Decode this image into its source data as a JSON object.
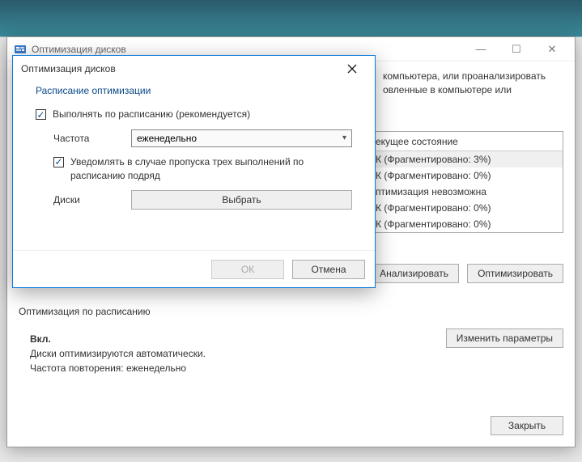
{
  "parent": {
    "title": "Оптимизация дисков",
    "desc_tail_line1": "компьютера, или проанализировать",
    "desc_tail_line2": "овленные в компьютере или",
    "table": {
      "header_state": "екущее состояние",
      "rows": [
        "К (Фрагментировано: 3%)",
        "К (Фрагментировано: 0%)",
        "птимизация невозможна",
        "К (Фрагментировано: 0%)",
        "К (Фрагментировано: 0%)"
      ]
    },
    "analyze_label": "Анализировать",
    "optimize_label": "Оптимизировать",
    "sched_heading": "Оптимизация по расписанию",
    "sched_on": "Вкл.",
    "sched_auto": "Диски оптимизируются автоматически.",
    "sched_freq": "Частота повторения: еженедельно",
    "change_params_label": "Изменить параметры",
    "close_label": "Закрыть",
    "winctrl_min": "—",
    "winctrl_max": "☐",
    "winctrl_close": "✕"
  },
  "dialog": {
    "title": "Оптимизация дисков",
    "heading": "Расписание оптимизации",
    "chk_schedule": "Выполнять по расписанию (рекомендуется)",
    "freq_label": "Частота",
    "freq_value": "еженедельно",
    "chk_notify": "Уведомлять в случае пропуска трех выполнений по расписанию подряд",
    "disks_label": "Диски",
    "choose_label": "Выбрать",
    "ok_label": "ОК",
    "cancel_label": "Отмена"
  }
}
